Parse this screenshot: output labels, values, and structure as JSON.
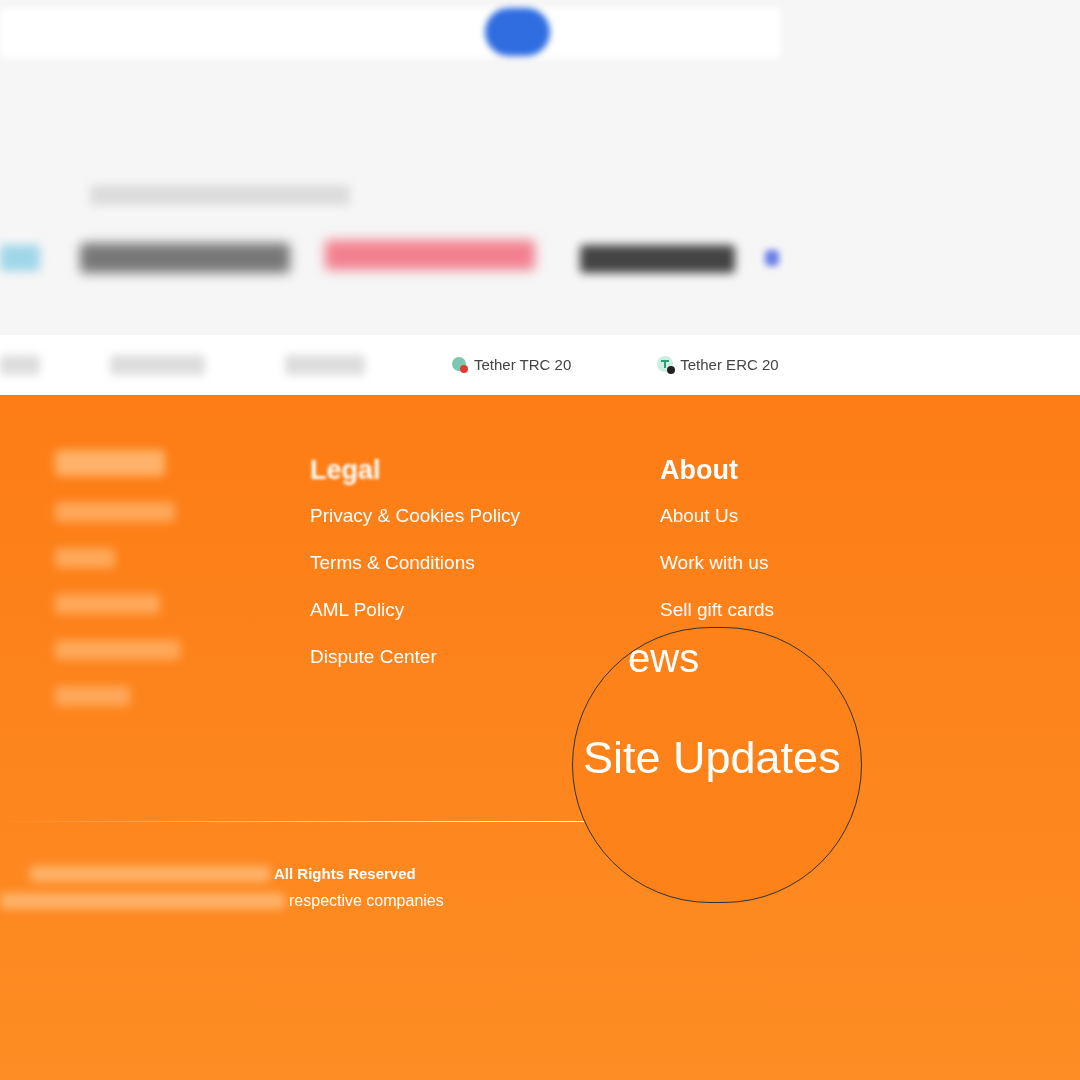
{
  "coins": [
    {
      "name": "Tether TRC 20",
      "kind": "trc"
    },
    {
      "name": "Tether ERC 20",
      "kind": "erc"
    }
  ],
  "footer": {
    "columns": [
      {
        "heading": "Legal",
        "blurred": true,
        "links": [
          "Privacy & Cookies Policy",
          "Terms & Conditions",
          "AML Policy",
          "Dispute Center"
        ]
      },
      {
        "heading": "About",
        "blurred": false,
        "links": [
          "About Us",
          "Work with us",
          "Sell gift cards"
        ]
      }
    ],
    "copyright": [
      "All Rights Reserved",
      "respective companies"
    ]
  },
  "magnifier": {
    "partial_text": "ews",
    "text": "Site Updates"
  }
}
